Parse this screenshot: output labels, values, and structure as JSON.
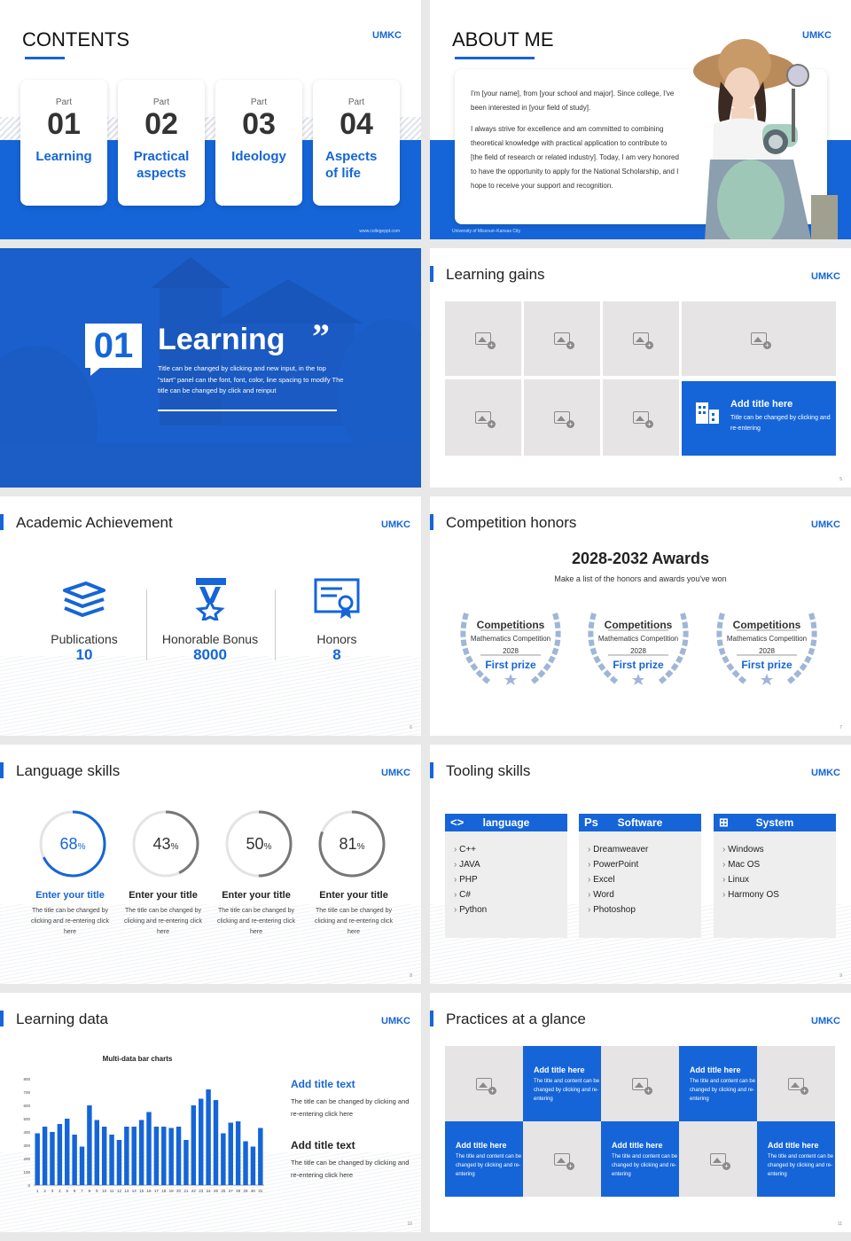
{
  "slides": {
    "contents": {
      "title": "CONTENTS",
      "logo": "UMKC",
      "footer": "www.collegeppt.com",
      "parts": [
        {
          "label": "Part",
          "num": "01",
          "title": "Learning"
        },
        {
          "label": "Part",
          "num": "02",
          "title": "Practical aspects"
        },
        {
          "label": "Part",
          "num": "03",
          "title": "Ideology"
        },
        {
          "label": "Part",
          "num": "04",
          "title": "Aspects of life"
        }
      ]
    },
    "about": {
      "title": "ABOUT ME",
      "logo": "UMKC",
      "p1": "I'm [your name], from [your school and major]. Since college, I've been interested in [your field of study].",
      "p2": "I always strive for excellence and am committed to combining theoretical knowledge with practical application to contribute to [the field of research or related industry]. Today, I am very honored to have the opportunity to apply for the National Scholarship, and I hope to receive your support and recognition.",
      "footer": "University of Missouri–Kansas City"
    },
    "section": {
      "num": "01",
      "title": "Learning",
      "quote": "”",
      "desc": "Title can be changed by clicking and new input, in the top \"start\" panel can the font, font, color, line spacing to modify The title can be changed by click and reinput"
    },
    "gains": {
      "title": "Learning gains",
      "logo": "UMKC",
      "box_title": "Add title here",
      "box_desc": "Title can be changed by clicking and re-entering",
      "page": "5"
    },
    "academic": {
      "title": "Academic Achievement",
      "logo": "UMKC",
      "page": "6",
      "stats": [
        {
          "label": "Publications",
          "value": "10",
          "icon": "books-stack-icon"
        },
        {
          "label": "Honorable Bonus",
          "value": "8000",
          "icon": "medal-icon"
        },
        {
          "label": "Honors",
          "value": "8",
          "icon": "certificate-icon"
        }
      ]
    },
    "honors": {
      "title": "Competition honors",
      "logo": "UMKC",
      "page": "7",
      "heading": "2028-2032 Awards",
      "sub": "Make a list of the honors and awards you've won",
      "awards": [
        {
          "cat": "Competitions",
          "name": "Mathematics Competition",
          "year": "2028",
          "prize": "First prize"
        },
        {
          "cat": "Competitions",
          "name": "Mathematics Competition",
          "year": "2028",
          "prize": "First prize"
        },
        {
          "cat": "Competitions",
          "name": "Mathematics Competition",
          "year": "2028",
          "prize": "First prize"
        }
      ]
    },
    "language": {
      "title": "Language skills",
      "logo": "UMKC",
      "page": "8",
      "items": [
        {
          "pct": "68",
          "unit": "%",
          "value": 0.68,
          "title": "Enter your title",
          "desc": "The title can be changed by clicking and re-entering click here",
          "accent": true
        },
        {
          "pct": "43",
          "unit": "%",
          "value": 0.43,
          "title": "Enter your title",
          "desc": "The title can be changed by clicking and re-entering click here",
          "accent": false
        },
        {
          "pct": "50",
          "unit": "%",
          "value": 0.5,
          "title": "Enter your title",
          "desc": "The title can be changed by clicking and re-entering click here",
          "accent": false
        },
        {
          "pct": "81",
          "unit": "%",
          "value": 0.81,
          "title": "Enter your title",
          "desc": "The title can be changed by clicking and re-entering click here",
          "accent": false
        }
      ]
    },
    "tooling": {
      "title": "Tooling skills",
      "logo": "UMKC",
      "page": "9",
      "cols": [
        {
          "icon": "code-icon",
          "head": "language",
          "items": [
            "C++",
            "JAVA",
            "PHP",
            "C#",
            "Python"
          ]
        },
        {
          "icon": "photoshop-icon",
          "head": "Software",
          "items": [
            "Dreamweaver",
            "PowerPoint",
            "Excel",
            "Word",
            "Photoshop"
          ]
        },
        {
          "icon": "windows-icon",
          "head": "System",
          "items": [
            "Windows",
            "Mac OS",
            "Linux",
            "Harmony OS"
          ]
        }
      ]
    },
    "data": {
      "title": "Learning data",
      "logo": "UMKC",
      "page": "10",
      "t1": "Add title text",
      "d1": "The title can be changed by clicking and re-entering click here",
      "t2": "Add title text",
      "d2": "The title can be changed by clicking and re-entering click here"
    },
    "practices": {
      "title": "Practices at a glance",
      "logo": "UMKC",
      "page": "11",
      "box_title": "Add title here",
      "box_desc": "The title and content can be changed by clicking and re-entering"
    }
  },
  "chart_data": {
    "type": "bar",
    "title": "Multi-data bar charts",
    "ylim": [
      0,
      800
    ],
    "yticks": [
      "0",
      "100",
      "200",
      "300",
      "400",
      "500",
      "600",
      "700",
      "800"
    ],
    "categories": [
      "1",
      "2",
      "3",
      "4",
      "5",
      "6",
      "7",
      "8",
      "9",
      "10",
      "11",
      "12",
      "13",
      "14",
      "15",
      "16",
      "17",
      "18",
      "19",
      "20",
      "21",
      "22",
      "23",
      "24",
      "25",
      "26",
      "27",
      "28",
      "29",
      "30",
      "31"
    ],
    "values": [
      390,
      440,
      400,
      460,
      500,
      380,
      290,
      600,
      490,
      440,
      380,
      340,
      440,
      440,
      490,
      550,
      440,
      440,
      430,
      440,
      340,
      600,
      650,
      720,
      640,
      390,
      470,
      480,
      330,
      290,
      430
    ],
    "color": "#1565d8"
  },
  "colors": {
    "accent": "#1565d8"
  }
}
